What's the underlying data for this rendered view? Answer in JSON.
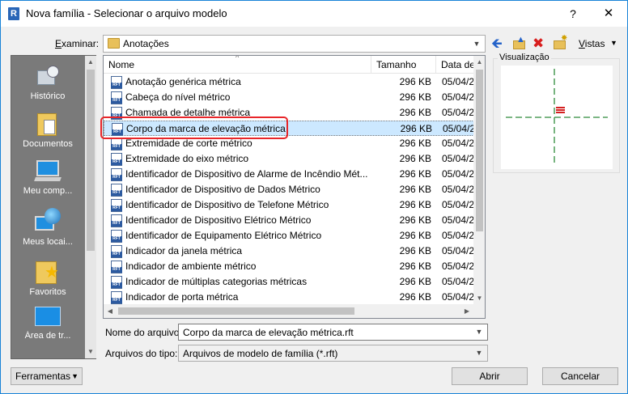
{
  "window": {
    "title": "Nova família - Selecionar o arquivo modelo",
    "app_icon_letter": "R",
    "help_label": "?",
    "close_label": "✕"
  },
  "toolbar": {
    "examinar_label": "Examinar:",
    "current_folder": "Anotações",
    "views_label": "Vistas"
  },
  "places": [
    {
      "label": "Histórico",
      "icon": "history-icon"
    },
    {
      "label": "Documentos",
      "icon": "documents-folder-icon"
    },
    {
      "label": "Meu comp...",
      "icon": "computer-icon"
    },
    {
      "label": "Meus locai...",
      "icon": "network-places-icon"
    },
    {
      "label": "Favoritos",
      "icon": "favorites-folder-icon"
    },
    {
      "label": "Área de tr...",
      "icon": "desktop-icon"
    }
  ],
  "columns": {
    "name": "Nome",
    "size": "Tamanho",
    "date": "Data de"
  },
  "files": [
    {
      "name": "Anotação genérica métrica",
      "size": "296 KB",
      "date": "05/04/2"
    },
    {
      "name": "Cabeça do nível métrico",
      "size": "296 KB",
      "date": "05/04/2"
    },
    {
      "name": "Chamada de detalhe métrica",
      "size": "296 KB",
      "date": "05/04/2"
    },
    {
      "name": "Corpo da marca de elevação métrica",
      "size": "296 KB",
      "date": "05/04/2"
    },
    {
      "name": "Extremidade de corte métrico",
      "size": "296 KB",
      "date": "05/04/2"
    },
    {
      "name": "Extremidade do eixo métrico",
      "size": "296 KB",
      "date": "05/04/2"
    },
    {
      "name": "Identificador de Dispositivo de Alarme de Incêndio Mét...",
      "size": "296 KB",
      "date": "05/04/2"
    },
    {
      "name": "Identificador de Dispositivo de Dados Métrico",
      "size": "296 KB",
      "date": "05/04/2"
    },
    {
      "name": "Identificador de Dispositivo de Telefone Métrico",
      "size": "296 KB",
      "date": "05/04/2"
    },
    {
      "name": "Identificador de Dispositivo Elétrico Métrico",
      "size": "296 KB",
      "date": "05/04/2"
    },
    {
      "name": "Identificador de Equipamento Elétrico Métrico",
      "size": "296 KB",
      "date": "05/04/2"
    },
    {
      "name": "Indicador da janela métrica",
      "size": "296 KB",
      "date": "05/04/2"
    },
    {
      "name": "Indicador de ambiente métrico",
      "size": "296 KB",
      "date": "05/04/2"
    },
    {
      "name": "Indicador de múltiplas categorias métricas",
      "size": "296 KB",
      "date": "05/04/2"
    },
    {
      "name": "Indicador de porta métrica",
      "size": "296 KB",
      "date": "05/04/2"
    }
  ],
  "file_type_tag": "RFT",
  "selected_index": 3,
  "preview": {
    "label": "Visualização"
  },
  "filename": {
    "label": "Nome do arquivo:",
    "value": "Corpo da marca de elevação métrica.rft"
  },
  "filetype": {
    "label": "Arquivos do tipo:",
    "value": "Arquivos de modelo de família  (*.rft)"
  },
  "buttons": {
    "tools": "Ferramentas",
    "open": "Abrir",
    "cancel": "Cancelar"
  },
  "colors": {
    "selection": "#cce8ff",
    "highlight": "#e8262a",
    "preview_line": "#2e8b3a",
    "preview_mark": "#d42020"
  }
}
